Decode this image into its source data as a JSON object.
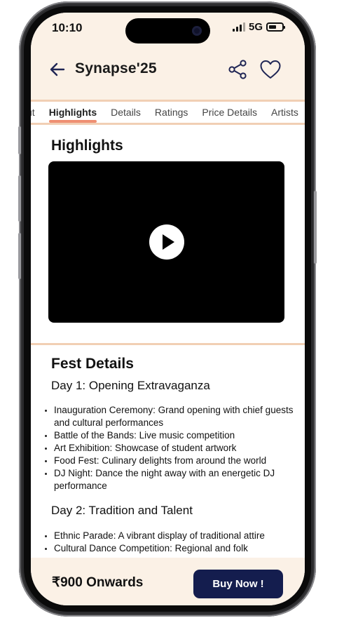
{
  "status_bar": {
    "time": "10:10",
    "network": "5G",
    "icons": [
      "cellular-signal-icon",
      "battery-icon"
    ]
  },
  "header": {
    "title": "Synapse'25",
    "icons": [
      "back-arrow-icon",
      "share-icon",
      "heart-icon"
    ]
  },
  "tabs": [
    {
      "label": "ut",
      "active": false
    },
    {
      "label": "Highlights",
      "active": true
    },
    {
      "label": "Details",
      "active": false
    },
    {
      "label": "Ratings",
      "active": false
    },
    {
      "label": "Price Details",
      "active": false
    },
    {
      "label": "Artists",
      "active": false
    }
  ],
  "highlights": {
    "title": "Highlights",
    "video_icon": "play-icon"
  },
  "fest_details": {
    "title": "Fest Details",
    "days": [
      {
        "heading": "Day 1: Opening Extravaganza",
        "items": [
          "Inauguration Ceremony: Grand opening with chief guests and cultural performances",
          "Battle of the Bands: Live music competition",
          "Art Exhibition: Showcase of student artwork",
          "Food Fest: Culinary delights from around the world",
          "DJ Night: Dance the night away with an energetic DJ performance"
        ]
      },
      {
        "heading": "Day 2: Tradition and Talent",
        "items": [
          "Ethnic Parade: A vibrant display of traditional attire",
          "Cultural Dance Competition: Regional and folk"
        ]
      }
    ]
  },
  "footer": {
    "price": "₹900 Onwards",
    "buy_label": "Buy Now !"
  },
  "colors": {
    "header_bg": "#fbf1e6",
    "accent_tab": "#ef8f73",
    "divider": "#f1cfb4",
    "buy_button": "#141d4e"
  }
}
